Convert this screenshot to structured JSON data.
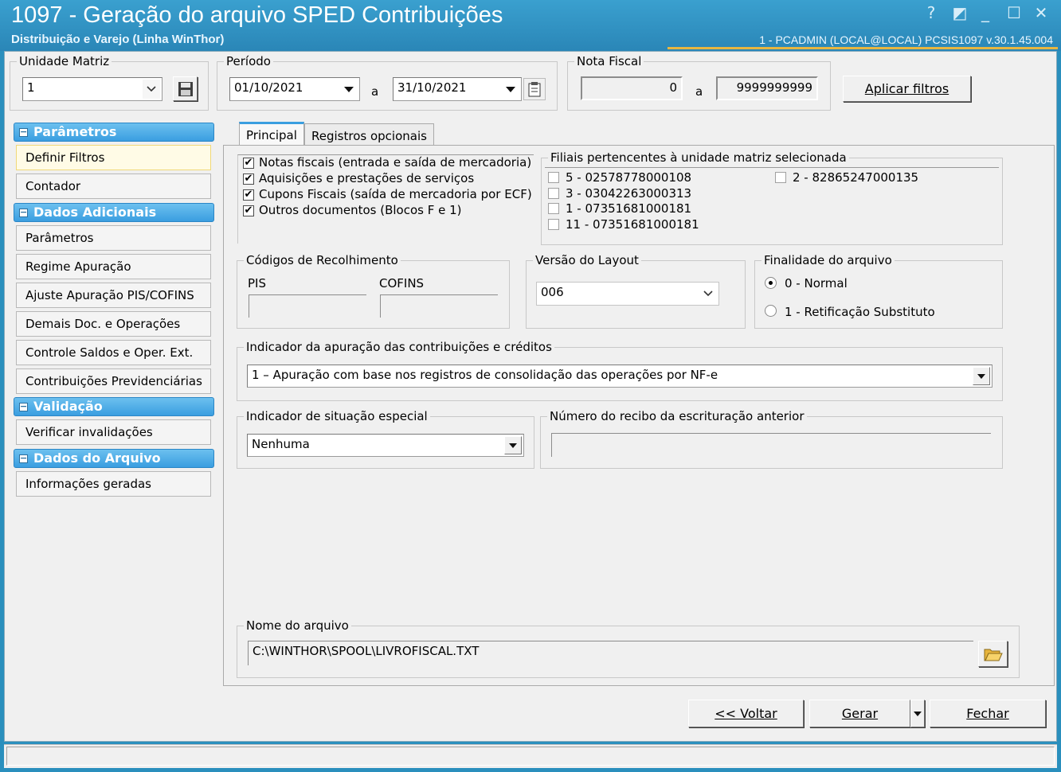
{
  "window": {
    "title": "1097 - Geração do arquivo SPED Contribuições",
    "subtitle": "Distribuição e Varejo (Linha WinThor)",
    "user_info": "1 - PCADMIN (LOCAL@LOCAL)   PCSIS1097  v.30.1.45.004",
    "help_glyph": "?",
    "restore_glyph": "◩",
    "minimize_glyph": "_",
    "maximize_glyph": "☐",
    "close_glyph": "✕"
  },
  "filters": {
    "unidade_label": "Unidade Matriz",
    "unidade_value": "1",
    "periodo_label": "Período",
    "periodo_from": "01/10/2021",
    "periodo_sep": "a",
    "periodo_to": "31/10/2021",
    "nota_label": "Nota Fiscal",
    "nota_from": "0",
    "nota_sep": "a",
    "nota_to": "9999999999",
    "apply_button": "Aplicar filtros"
  },
  "sidebar": {
    "sections": [
      {
        "title": "Parâmetros",
        "items": [
          "Definir Filtros",
          "Contador"
        ]
      },
      {
        "title": "Dados Adicionais",
        "items": [
          "Parâmetros",
          "Regime Apuração",
          "Ajuste Apuração PIS/COFINS",
          "Demais Doc. e Operações",
          "Controle Saldos e Oper. Ext.",
          "Contribuições Previdenciárias"
        ]
      },
      {
        "title": "Validação",
        "items": [
          "Verificar invalidações"
        ]
      },
      {
        "title": "Dados do Arquivo",
        "items": [
          "Informações geradas"
        ]
      }
    ],
    "minus_glyph": "−"
  },
  "tabs": [
    "Principal",
    "Registros opcionais"
  ],
  "principal": {
    "doc_checks": [
      "Notas fiscais (entrada e saída de mercadoria)",
      "Aquisições e prestações de serviços",
      "Cupons Fiscais (saída de mercadoria por ECF)",
      "Outros documentos (Blocos F e 1)"
    ],
    "check_glyph": "✔",
    "filiais_label": "Filiais pertencentes à unidade matriz selecionada",
    "filiais": [
      "5 - 02578778000108",
      "3 - 03042263000313",
      "1 - 07351681000181",
      "11 - 07351681000181",
      "2 - 82865247000135"
    ],
    "codigos_label": "Códigos de Recolhimento",
    "pis_label": "PIS",
    "cofins_label": "COFINS",
    "versao_label": "Versão do Layout",
    "versao_value": "006",
    "finalidade_label": "Finalidade do arquivo",
    "finalidade_options": [
      "0 - Normal",
      "1 - Retificação Substituto"
    ],
    "indicador_apuracao_label": "Indicador da apuração das contribuições e créditos",
    "indicador_apuracao_value": "1 – Apuração com base nos registros de consolidação das operações por NF-e",
    "situacao_label": "Indicador de situação especial",
    "situacao_value": "Nenhuma",
    "recibo_label": "Número do recibo da escrituração anterior",
    "recibo_value": "",
    "arquivo_label": "Nome do arquivo",
    "arquivo_value": "C:\\WINTHOR\\SPOOL\\LIVROFISCAL.TXT"
  },
  "footer": {
    "voltar": "<< Voltar",
    "gerar": "Gerar",
    "fechar": "Fechar"
  },
  "colors": {
    "accent": "#3a9ee0",
    "titlebar": "#2a8fbd"
  }
}
